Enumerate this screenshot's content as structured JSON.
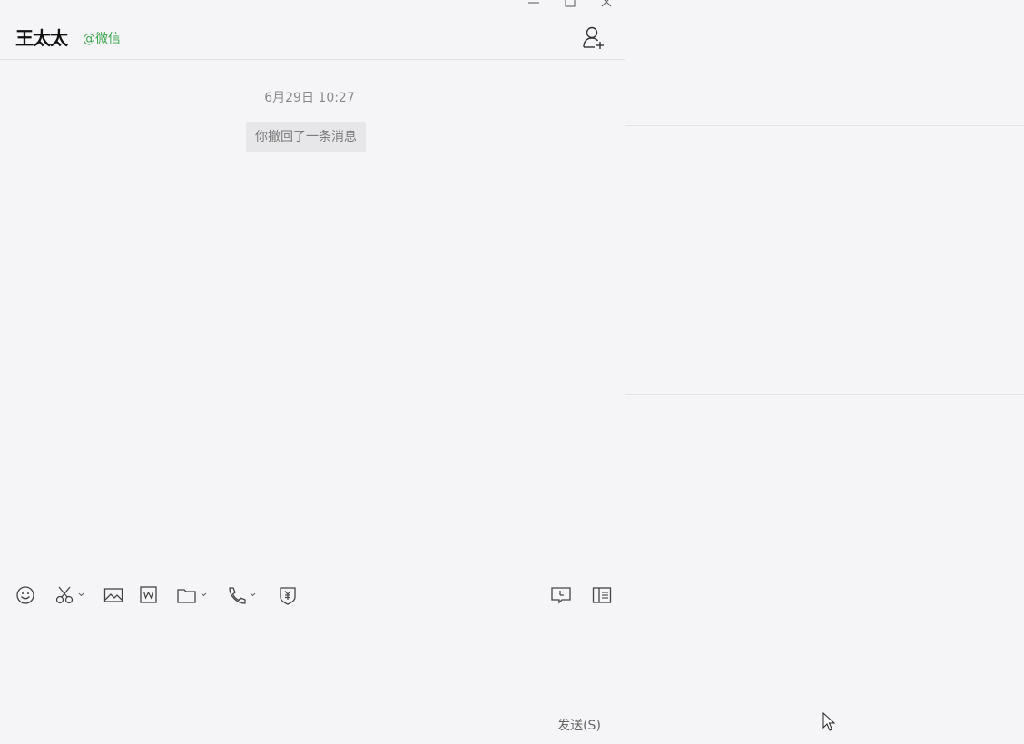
{
  "header": {
    "contact_name": "王太太",
    "contact_source": "@微信",
    "add_member_icon": "add-person-icon"
  },
  "window_controls": {
    "minimize_icon": "minimize-icon",
    "maximize_icon": "maximize-icon",
    "close_icon": "close-icon"
  },
  "messages": {
    "timestamp": "6月29日 10:27",
    "system_notice": "你撤回了一条消息"
  },
  "toolbar": {
    "tools": [
      {
        "name": "emoji-icon"
      },
      {
        "name": "screenshot-scissors-icon"
      },
      {
        "name": "image-icon"
      },
      {
        "name": "word-document-icon"
      },
      {
        "name": "folder-icon"
      },
      {
        "name": "phone-call-icon"
      },
      {
        "name": "red-packet-shield-icon"
      },
      {
        "name": "chat-history-icon"
      },
      {
        "name": "side-panel-icon"
      }
    ]
  },
  "input": {
    "send_label": "发送(S)"
  },
  "colors": {
    "background": "#f5f5f7",
    "accent_green": "#3aa54c",
    "system_bubble": "#e7e7e9",
    "muted_text": "#8b8b8b"
  }
}
